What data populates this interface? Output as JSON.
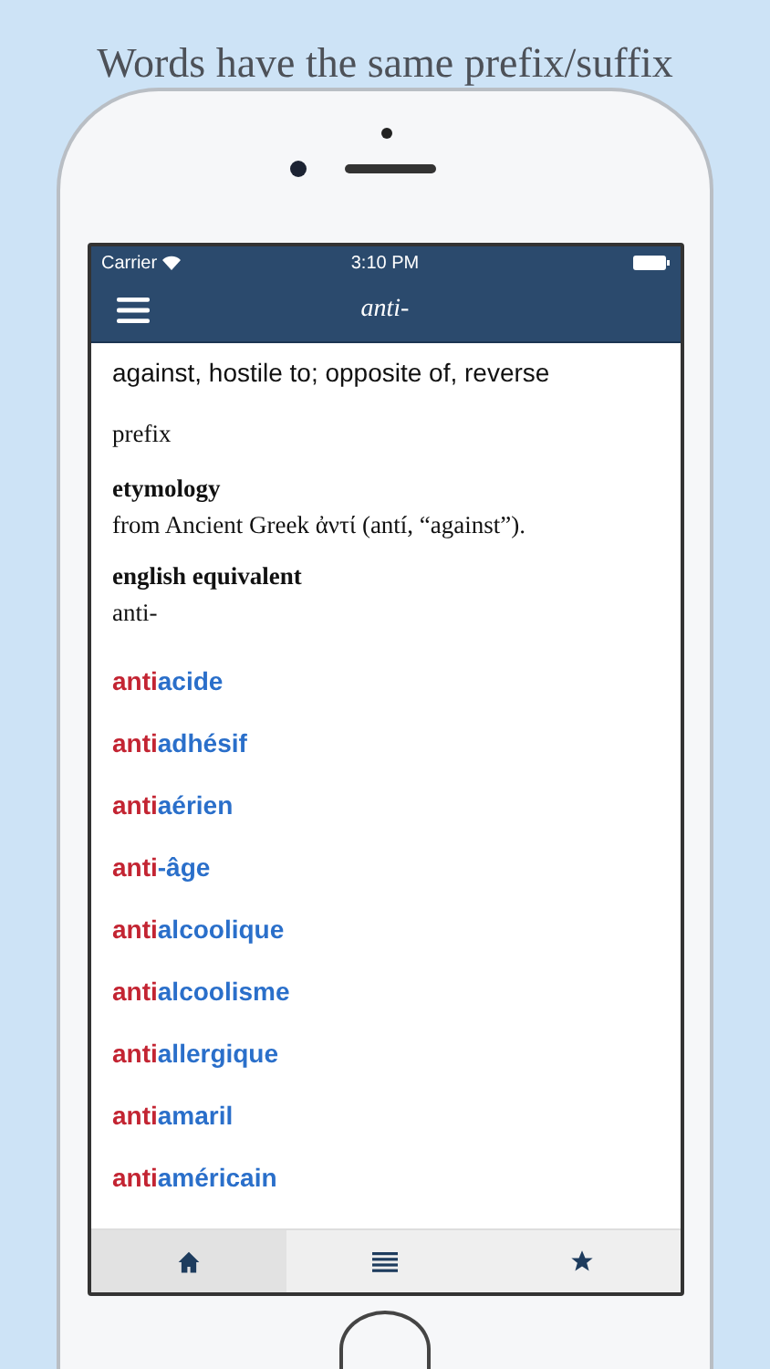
{
  "caption": "Words have the same prefix/suffix",
  "status_bar": {
    "carrier": "Carrier",
    "time": "3:10 PM"
  },
  "nav_bar": {
    "title": "anti-"
  },
  "entry": {
    "definition": "against, hostile to; opposite of, reverse",
    "part_of_speech": "prefix",
    "sections": [
      {
        "heading": "etymology",
        "text": "from Ancient Greek ἀντί (antí, “against”)."
      },
      {
        "heading": "english equivalent",
        "text": "anti-"
      }
    ]
  },
  "words": [
    {
      "prefix": "anti",
      "rest": "acide"
    },
    {
      "prefix": "anti",
      "rest": "adhésif"
    },
    {
      "prefix": "anti",
      "rest": "aérien"
    },
    {
      "prefix": "anti",
      "rest": "-âge"
    },
    {
      "prefix": "anti",
      "rest": "alcoolique"
    },
    {
      "prefix": "anti",
      "rest": "alcoolisme"
    },
    {
      "prefix": "anti",
      "rest": "allergique"
    },
    {
      "prefix": "anti",
      "rest": "amaril"
    },
    {
      "prefix": "anti",
      "rest": "américain"
    }
  ],
  "tab_bar": [
    {
      "kind": "home",
      "selected": true
    },
    {
      "kind": "list",
      "selected": false
    },
    {
      "kind": "star",
      "selected": false
    }
  ]
}
